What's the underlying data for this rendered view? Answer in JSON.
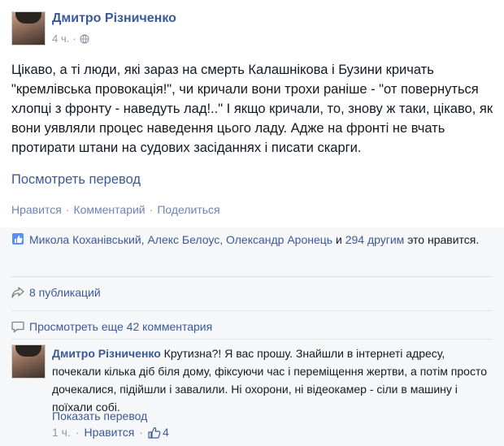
{
  "post": {
    "author": "Дмитро Різниченко",
    "time": "4 ч.",
    "text": "Цікаво, а ті люди, які зараз на смерть Калашнікова і Бузини кричать \"кремлівська провокація!\", чи кричали вони трохи раніше - \"от повернуться хлопці з фронту - наведуть лад!..\" І якщо кричали, то, знову ж таки, цікаво, як вони уявляли процес наведення цього ладу. Адже на фронті не вчать протирати штани на судових засіданнях і писати скарги.",
    "translate_label": "Посмотреть перевод",
    "actions": {
      "like": "Нравится",
      "comment": "Комментарий",
      "share": "Поделиться"
    }
  },
  "feedback": {
    "likes": {
      "names": "Микола Коханівський, Алекс Белоус, Олександр Аронець",
      "conjunction": "и",
      "others": "294 другим",
      "suffix": "это нравится."
    },
    "shares": "8 публикаций",
    "more_comments": "Просмотреть еще 42 комментария"
  },
  "comment": {
    "author": "Дмитро Різниченко",
    "text": "Крутизна?! Я вас прошу. Знайшли в інтернеті адресу, почекали кілька діб біля дому, фіксуючи час і переміщення жертви, а потім просто дочекалися, підійшли і завалили. Ні охорони, ні відеокамер - сіли в машину і поїхали собі.",
    "translate_label": "Показать перевод",
    "time": "1 ч.",
    "like_label": "Нравится",
    "like_count": "4"
  },
  "colors": {
    "link": "#3b5998",
    "muted": "#9197a3",
    "text": "#141823",
    "feedback_bg": "#f6f7f9"
  },
  "icons": [
    "globe-icon",
    "like-thumb-icon",
    "share-arrow-icon",
    "comment-bubble-icon"
  ]
}
